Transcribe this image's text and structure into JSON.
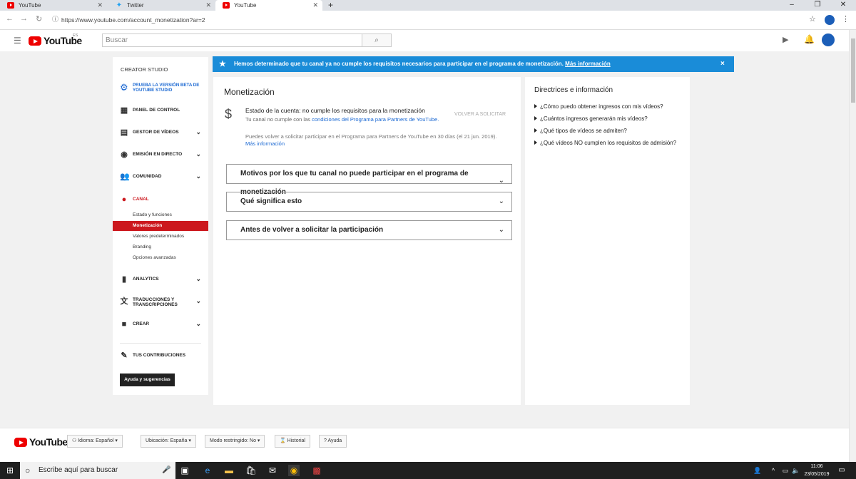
{
  "browser": {
    "tabs": [
      {
        "title": "YouTube",
        "icon": "youtube-icon",
        "active": false
      },
      {
        "title": "Twitter",
        "icon": "twitter-icon",
        "active": false
      },
      {
        "title": "YouTube",
        "icon": "youtube-icon",
        "active": true
      }
    ],
    "url": "https://www.youtube.com/account_monetization?ar=2",
    "new_tab": "+"
  },
  "header": {
    "logo": "YouTube",
    "region": "ES",
    "search_placeholder": "Buscar"
  },
  "sidebar": {
    "title": "CREATOR STUDIO",
    "beta": "PRUEBA LA VERSIÓN BETA DE YOUTUBE STUDIO",
    "items": [
      {
        "label": "PANEL DE CONTROL",
        "icon": "dashboard-icon"
      },
      {
        "label": "GESTOR DE VÍDEOS",
        "icon": "video-manager-icon"
      },
      {
        "label": "EMISIÓN EN DIRECTO",
        "icon": "live-icon"
      },
      {
        "label": "COMUNIDAD",
        "icon": "community-icon"
      },
      {
        "label": "CANAL",
        "icon": "channel-icon"
      }
    ],
    "sub_items": [
      "Estado y funciones",
      "Monetización",
      "Valores predeterminados",
      "Branding",
      "Opciones avanzadas"
    ],
    "items2": [
      {
        "label": "ANALYTICS",
        "icon": "analytics-icon"
      },
      {
        "label": "TRADUCCIONES Y TRANSCRIPCIONES",
        "icon": "translate-icon"
      },
      {
        "label": "CREAR",
        "icon": "create-icon"
      }
    ],
    "contrib": "TUS CONTRIBUCIONES",
    "help_btn": "Ayuda y sugerencias"
  },
  "notice": {
    "text": "Hemos determinado que tu canal ya no cumple los requisitos necesarios para participar en el programa de monetización.",
    "link": "Más información",
    "close": "×"
  },
  "main": {
    "title": "Monetización",
    "status_title": "Estado de la cuenta: no cumple los requisitos para la monetización",
    "status_desc": "Tu canal no cumple con las",
    "status_link": "condiciones del Programa para Partners de YouTube.",
    "reapply_btn": "VOLVER A SOLICITAR",
    "reapply_note": "Puedes volver a solicitar participar en el Programa para Partners de YouTube en 30 días (el 21 jun. 2019).",
    "reapply_link": "Más información",
    "accordions": [
      "Motivos por los que tu canal no puede participar en el programa de monetización",
      "Qué significa esto",
      "Antes de volver a solicitar la participación"
    ]
  },
  "right": {
    "title": "Directrices e información",
    "links": [
      "¿Cómo puedo obtener ingresos con mis vídeos?",
      "¿Cuántos ingresos generarán mis vídeos?",
      "¿Qué tipos de vídeos se admiten?",
      "¿Qué vídeos NO cumplen los requisitos de admisión?"
    ]
  },
  "footer": {
    "logo": "YouTube",
    "language": "Idioma: Español",
    "location": "Ubicación: España",
    "restricted": "Modo restringido: No",
    "history": "Historial",
    "help": "Ayuda"
  },
  "taskbar": {
    "search_placeholder": "Escribe aquí para buscar",
    "time": "11:06",
    "date": "23/05/2019"
  },
  "colors": {
    "accent_red": "#cc181e",
    "notice_blue": "#1a8cd8",
    "link_blue": "#1967d2"
  }
}
